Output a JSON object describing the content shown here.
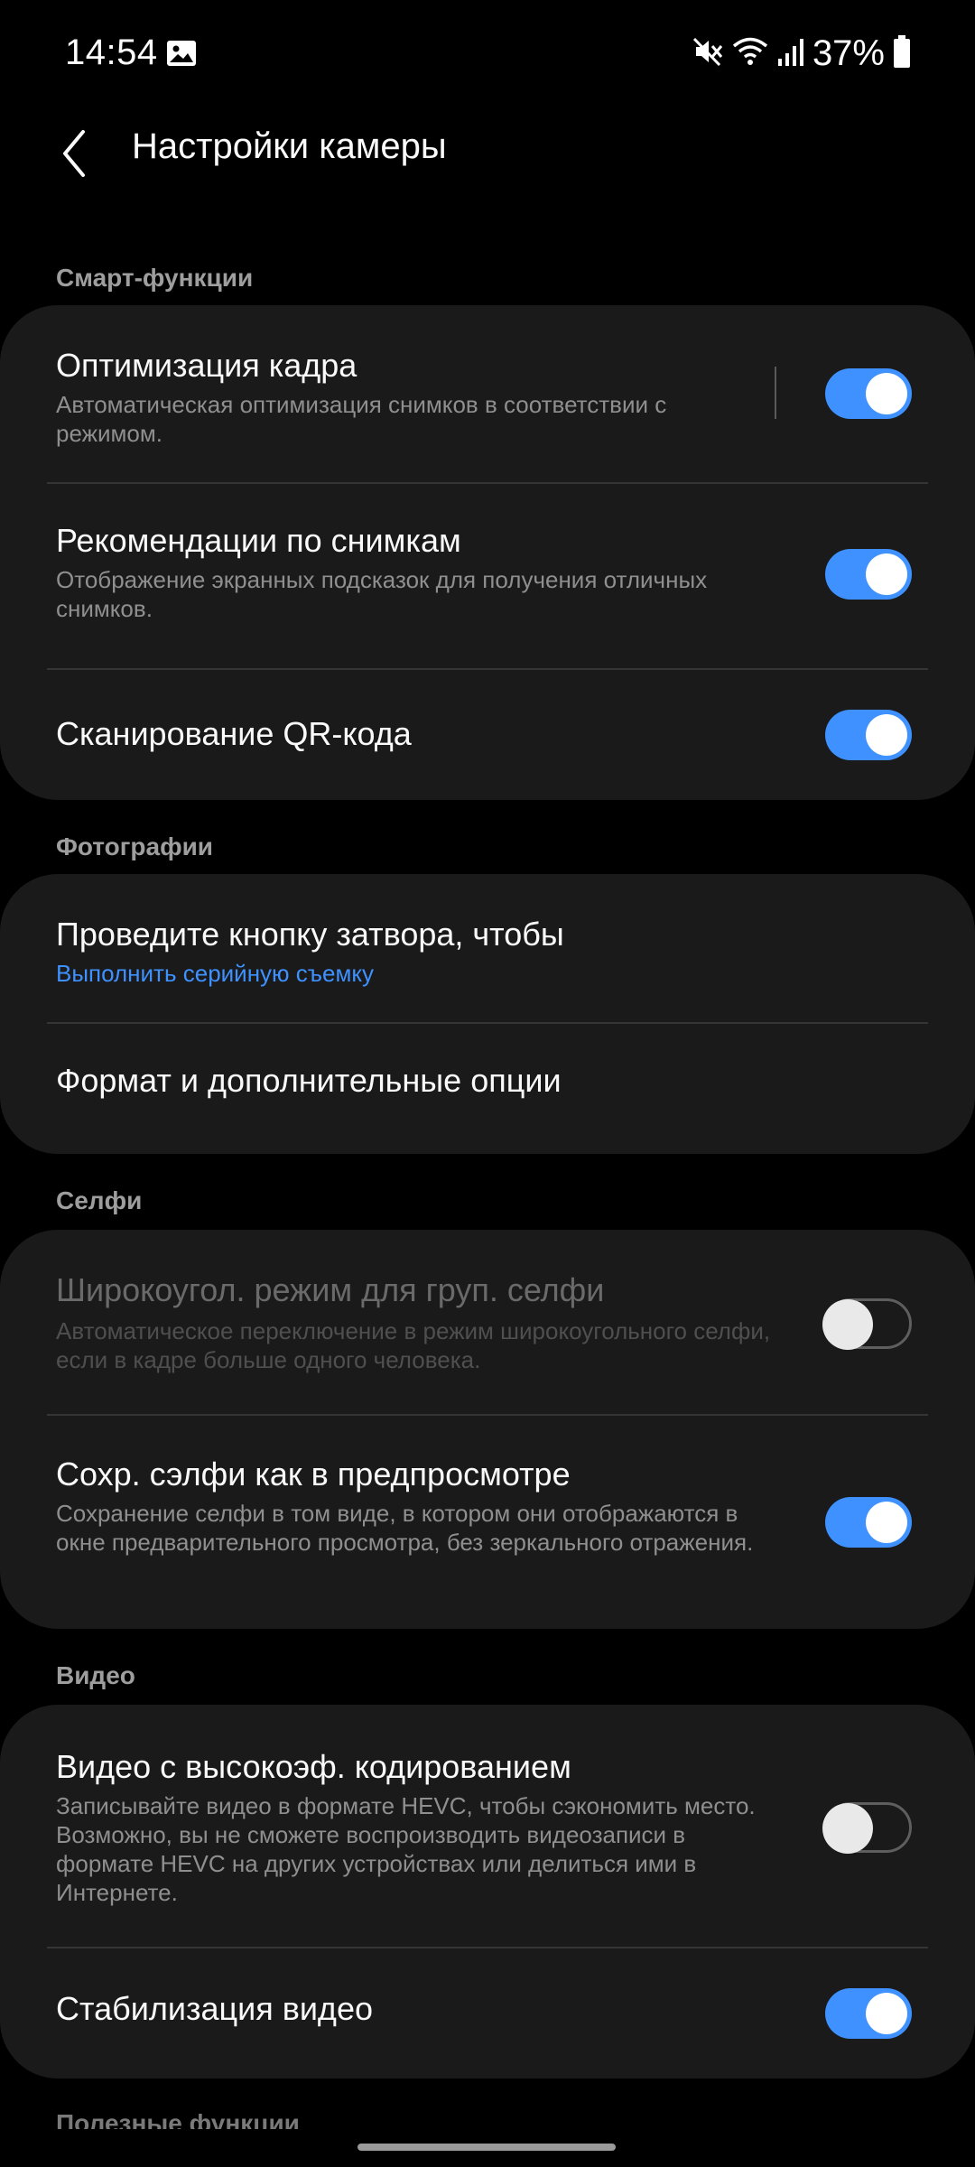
{
  "status_bar": {
    "time": "14:54",
    "battery": "37%",
    "icons": [
      "image-icon",
      "mute-icon",
      "wifi-icon",
      "signal-icon",
      "battery-icon"
    ]
  },
  "app_bar": {
    "title": "Настройки камеры",
    "back_icon": "chevron-left-icon"
  },
  "sections": {
    "smart": {
      "header": "Смарт-функции",
      "items": [
        {
          "title": "Оптимизация кадра",
          "subtitle": "Автоматическая оптимизация снимков в соответствии с режимом.",
          "toggle": true
        },
        {
          "title": "Рекомендации по снимкам",
          "subtitle": "Отображение экранных подсказок для получения отличных снимков.",
          "toggle": true
        },
        {
          "title": "Сканирование QR-кода",
          "toggle": true
        }
      ]
    },
    "photos": {
      "header": "Фотографии",
      "items": [
        {
          "title": "Проведите кнопку затвора, чтобы",
          "subtitle": "Выполнить серийную съемку"
        },
        {
          "title": "Формат и дополнительные опции"
        }
      ]
    },
    "selfie": {
      "header": "Селфи",
      "items": [
        {
          "title": "Широкоугол. режим для груп. селфи",
          "subtitle": "Автоматическое переключение в режим широкоугольного селфи, если в кадре больше одного человека.",
          "toggle": false,
          "disabled": true
        },
        {
          "title": "Сохр. сэлфи как в предпросмотре",
          "subtitle": "Сохранение селфи в том виде, в котором они отображаются в окне предварительного просмотра, без зеркального отражения.",
          "toggle": true
        }
      ]
    },
    "video": {
      "header": "Видео",
      "items": [
        {
          "title": "Видео с высокоэф. кодированием",
          "subtitle": "Записывайте видео в формате HEVC, чтобы сэкономить место. Возможно, вы не сможете воспроизводить видеозаписи в формате HEVC на других устройствах или делиться ими в Интернете.",
          "toggle": false
        },
        {
          "title": "Стабилизация видео",
          "toggle": true
        }
      ]
    },
    "useful": {
      "header": "Полезные функции"
    }
  },
  "colors": {
    "accent": "#3e91ff",
    "background": "#000000",
    "card": "#1a1a1a"
  }
}
